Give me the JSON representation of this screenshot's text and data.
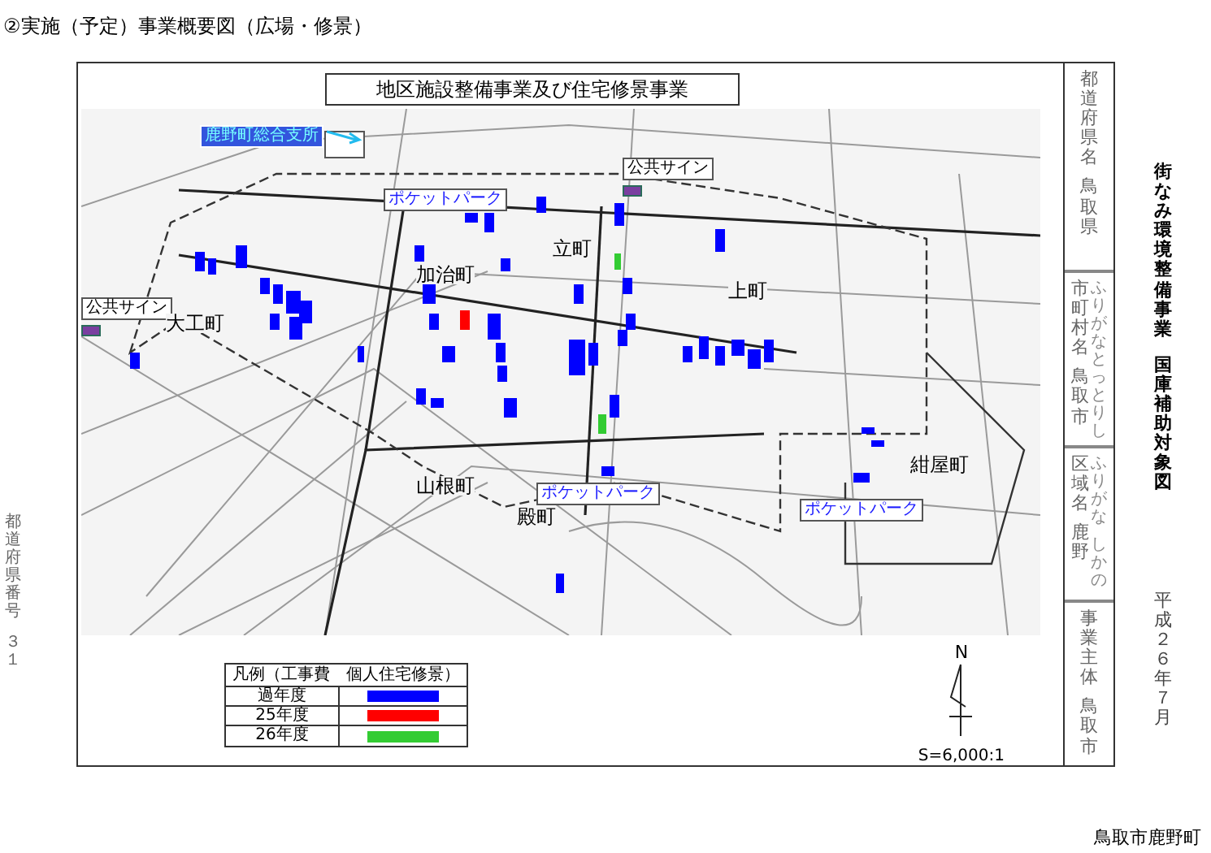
{
  "heading": "②実施（予定）事業概要図（広場・修景）",
  "map_panel": {
    "title": "地区施設整備事業及び住宅修景事業",
    "labels": [
      {
        "kind": "office",
        "text": "鹿野町総合支所"
      },
      {
        "kind": "sign",
        "text": "公共サイン"
      },
      {
        "kind": "park",
        "text": "ポケットパーク"
      },
      {
        "kind": "town",
        "text": "立町"
      },
      {
        "kind": "town",
        "text": "加治町"
      },
      {
        "kind": "town",
        "text": "上町"
      },
      {
        "kind": "sign",
        "text": "公共サイン"
      },
      {
        "kind": "town",
        "text": "大工町"
      },
      {
        "kind": "town",
        "text": "紺屋町"
      },
      {
        "kind": "town",
        "text": "山根町"
      },
      {
        "kind": "park",
        "text": "ポケットパーク"
      },
      {
        "kind": "park",
        "text": "ポケットパーク"
      },
      {
        "kind": "town",
        "text": "殿町"
      }
    ],
    "legend": {
      "title": "凡例（工事費　個人住宅修景）",
      "items": [
        {
          "label": "過年度",
          "color": "#0000ff"
        },
        {
          "label": "25年度",
          "color": "#ff0000"
        },
        {
          "label": "26年度",
          "color": "#33cc33"
        }
      ]
    },
    "north_label": "N",
    "scale": "S=6,000:1"
  },
  "prefecture_number": {
    "label": "都道府県番号",
    "value": "３１"
  },
  "info_table": [
    {
      "label": "都道府県名",
      "value": "鳥取県"
    },
    {
      "label": "市町村名",
      "value": "鳥取市",
      "furigana_label": "ふりがな",
      "furigana_value": "とっとりし"
    },
    {
      "label": "区域名",
      "value": "鹿野",
      "furigana_label": "ふりがな",
      "furigana_value": "しかの"
    },
    {
      "label": "事業主体",
      "value": "鳥取市"
    }
  ],
  "side_title": [
    "街なみ環境整備事業",
    "国庫補助対象図"
  ],
  "date": "平成２６年７月",
  "footer": "鳥取市鹿野町"
}
